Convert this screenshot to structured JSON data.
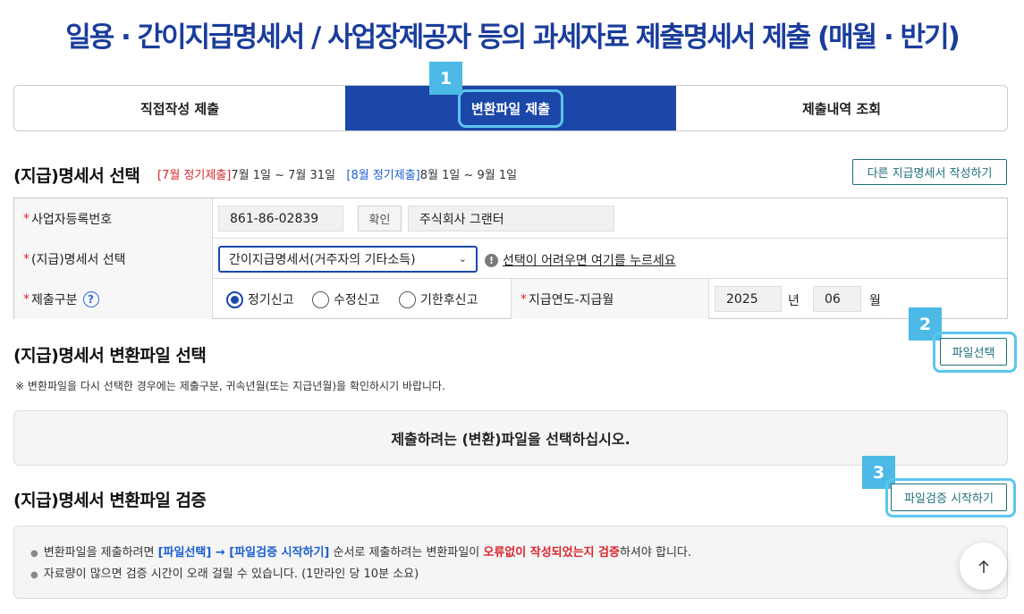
{
  "page_title": "일용 · 간이지급명세서 / 사업장제공자 등의 과세자료 제출명세서 제출 (매월 · 반기)",
  "tabs": [
    {
      "label": "직접작성 제출",
      "active": false
    },
    {
      "label": "변환파일 제출",
      "active": true
    },
    {
      "label": "제출내역 조회",
      "active": false
    }
  ],
  "badges": {
    "one": "1",
    "two": "2",
    "three": "3"
  },
  "statement_select": {
    "title": "(지급)명세서 선택",
    "period_july_tag": "[7월 정기제출]",
    "period_july_range": "7월 1일 ~ 7월 31일",
    "period_aug_tag": "[8월 정기제출]",
    "period_aug_range": "8월 1일 ~ 9월 1일",
    "other_button": "다른 지급명세서 작성하기"
  },
  "form": {
    "biz_no_label": "사업자등록번호",
    "biz_no_value": "861-86-02839",
    "confirm_button": "확인",
    "company_name": "주식회사 그랜터",
    "statement_label": "(지급)명세서 선택",
    "statement_value": "간이지급명세서(거주자의 기타소득)",
    "help_link": "선택이 어려우면 여기를 누르세요",
    "submit_type_label": "제출구분",
    "radio_options": [
      "정기신고",
      "수정신고",
      "기한후신고"
    ],
    "radio_selected": "정기신고",
    "pay_month_label": "지급연도-지급월",
    "year_value": "2025",
    "year_unit": "년",
    "month_value": "06",
    "month_unit": "월"
  },
  "file_select": {
    "title": "(지급)명세서 변환파일 선택",
    "button": "파일선택",
    "note": "※ 변환파일을 다시 선택한 경우에는 제출구분, 귀속년월(또는 지급년월)을 확인하시기 바랍니다.",
    "placeholder": "제출하려는 (변환)파일을 선택하십시오."
  },
  "file_verify": {
    "title": "(지급)명세서 변환파일 검증",
    "button": "파일검증 시작하기",
    "line1_a": "변환파일을 제출하려면 ",
    "line1_b": "[파일선택] → [파일검증 시작하기]",
    "line1_c": " 순서로 제출하려는 변환파일이 ",
    "line1_d": "오류없이 작성되었는지 검증",
    "line1_e": "하셔야 합니다.",
    "line2": "자료량이 많으면 검증 시간이 오래 걸릴 수 있습니다. (1만라인 당 10분 소요)"
  },
  "colors": {
    "primary": "#1b47a8",
    "highlight": "#5cc6ee",
    "red": "#d9262c",
    "teal": "#1f6f7a"
  }
}
